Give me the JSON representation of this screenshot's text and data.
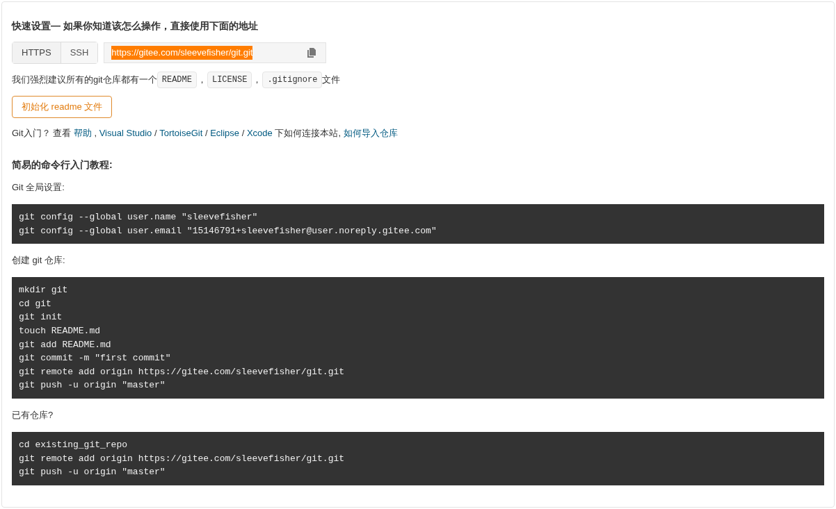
{
  "title": "快速设置— 如果你知道该怎么操作，直接使用下面的地址",
  "protocols": [
    {
      "label": "HTTPS",
      "selected": true
    },
    {
      "label": "SSH",
      "selected": false
    }
  ],
  "url": {
    "value": "https://gitee.com/sleevefisher/git.git",
    "highlighted": true
  },
  "recommend": {
    "text": "我们强烈建议所有的git仓库都有一个",
    "files": [
      "README",
      "LICENSE",
      ".gitignore"
    ],
    "separator": "，",
    "suffix": "文件"
  },
  "init_button": "初始化 readme 文件",
  "help_line": [
    {
      "kind": "text",
      "text": "Git入门？ 查看 "
    },
    {
      "kind": "link",
      "text": "帮助"
    },
    {
      "kind": "text",
      "text": " , "
    },
    {
      "kind": "link",
      "text": "Visual Studio"
    },
    {
      "kind": "text",
      "text": " / "
    },
    {
      "kind": "link",
      "text": "TortoiseGit"
    },
    {
      "kind": "text",
      "text": " / "
    },
    {
      "kind": "link",
      "text": "Eclipse"
    },
    {
      "kind": "text",
      "text": " / "
    },
    {
      "kind": "link",
      "text": "Xcode"
    },
    {
      "kind": "text",
      "text": " 下如何连接本站, "
    },
    {
      "kind": "link",
      "text": "如何导入仓库"
    }
  ],
  "tutorial_heading": "简易的命令行入门教程:",
  "sections": [
    {
      "label": "Git 全局设置:",
      "code": [
        "git config --global user.name \"sleevefisher\"",
        "git config --global user.email \"15146791+sleevefisher@user.noreply.gitee.com\""
      ]
    },
    {
      "label": "创建 git 仓库:",
      "code": [
        "mkdir git",
        "cd git",
        "git init",
        "touch README.md",
        "git add README.md",
        "git commit -m \"first commit\"",
        "git remote add origin https://gitee.com/sleevefisher/git.git",
        "git push -u origin \"master\""
      ]
    },
    {
      "label": "已有仓库?",
      "code": [
        "cd existing_git_repo",
        "git remote add origin https://gitee.com/sleevefisher/git.git",
        "git push -u origin \"master\""
      ]
    }
  ]
}
